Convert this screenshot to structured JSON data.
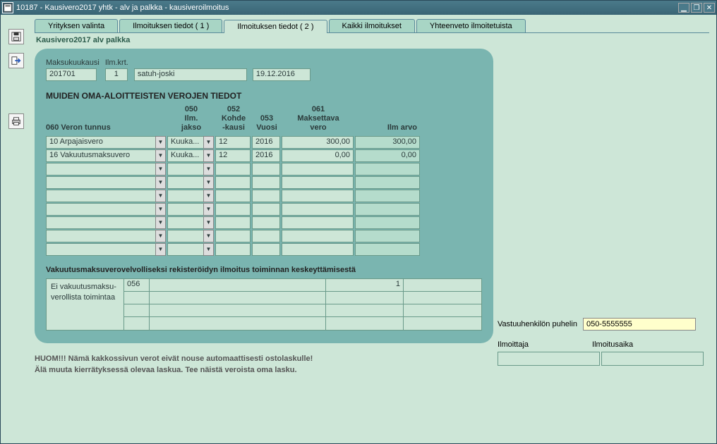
{
  "window": {
    "title": "10187 - Kausivero2017 yhtk - alv ja palkka - kausiveroilmoitus"
  },
  "tabs": {
    "items": [
      {
        "label": "Yrityksen valinta"
      },
      {
        "label": "Ilmoituksen tiedot ( 1 )"
      },
      {
        "label": "Ilmoituksen tiedot ( 2 )"
      },
      {
        "label": "Kaikki ilmoitukset"
      },
      {
        "label": "Yhteenveto ilmoitetuista"
      }
    ]
  },
  "page_label": "Kausivero2017 alv palkka",
  "header": {
    "maksukuukausi_label": "Maksukuukausi",
    "maksukuukausi": "201701",
    "ilmkrt_label": "Ilm.krt.",
    "ilmkrt": "1",
    "user": "satuh-joski",
    "date": "19.12.2016"
  },
  "section": {
    "title": "MUIDEN OMA-ALOITTEISTEN VEROJEN TIEDOT",
    "col_060": "060 Veron tunnus",
    "col_050a": "050",
    "col_050b": "Ilm.",
    "col_050c": "jakso",
    "col_052a": "052",
    "col_052b": "Kohde",
    "col_052c": "-kausi",
    "col_053a": "053",
    "col_053b": "Vuosi",
    "col_061a": "061",
    "col_061b": "Maksettava",
    "col_061c": "vero",
    "col_ilmarvo": "Ilm arvo"
  },
  "grid": {
    "rows": [
      {
        "tunnus": "10 Arpajaisvero",
        "jakso": "Kuuka...",
        "kausi": "12",
        "vuosi": "2016",
        "vero": "300,00",
        "ilm": "300,00"
      },
      {
        "tunnus": "16 Vakuutusmaksuvero",
        "jakso": "Kuuka...",
        "kausi": "12",
        "vuosi": "2016",
        "vero": "0,00",
        "ilm": "0,00"
      },
      {
        "tunnus": "",
        "jakso": "",
        "kausi": "",
        "vuosi": "",
        "vero": "",
        "ilm": ""
      },
      {
        "tunnus": "",
        "jakso": "",
        "kausi": "",
        "vuosi": "",
        "vero": "",
        "ilm": ""
      },
      {
        "tunnus": "",
        "jakso": "",
        "kausi": "",
        "vuosi": "",
        "vero": "",
        "ilm": ""
      },
      {
        "tunnus": "",
        "jakso": "",
        "kausi": "",
        "vuosi": "",
        "vero": "",
        "ilm": ""
      },
      {
        "tunnus": "",
        "jakso": "",
        "kausi": "",
        "vuosi": "",
        "vero": "",
        "ilm": ""
      },
      {
        "tunnus": "",
        "jakso": "",
        "kausi": "",
        "vuosi": "",
        "vero": "",
        "ilm": ""
      },
      {
        "tunnus": "",
        "jakso": "",
        "kausi": "",
        "vuosi": "",
        "vero": "",
        "ilm": ""
      }
    ]
  },
  "sub": {
    "title": "Vakuutusmaksuverovelvolliseksi rekisteröidyn ilmoitus toiminnan keskeyttämisestä",
    "left": "Ei vakuutusmaksu-verollista toimintaa",
    "code": "056",
    "val": "1"
  },
  "right": {
    "phone_label": "Vastuuhenkilön puhelin",
    "phone": "050-5555555",
    "ilmoittaja_label": "Ilmoittaja",
    "ilmoitusaika_label": "Ilmoitusaika"
  },
  "notice": {
    "line1": "HUOM!!! Nämä kakkossivun verot eivät nouse automaattisesti ostolaskulle!",
    "line2": "Älä muuta kierrätyksessä olevaa laskua. Tee näistä veroista oma lasku."
  }
}
